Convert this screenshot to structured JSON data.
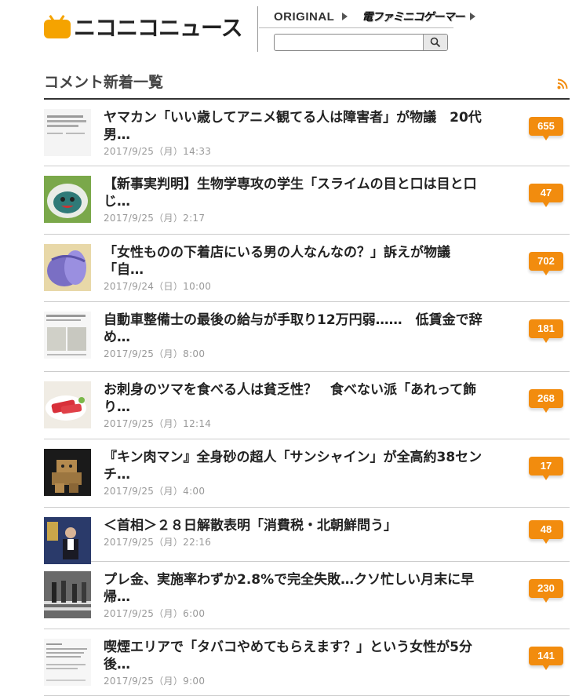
{
  "header": {
    "logo_text": "ニコニコニュース",
    "nav_original": "ORIGINAL",
    "nav_famitsu": "電ファミニコゲーマー",
    "search_placeholder": ""
  },
  "section": {
    "title": "コメント新着一覧",
    "rss_icon": "rss-icon"
  },
  "colors": {
    "accent": "#f28c0e",
    "logo_orange": "#f5a300"
  },
  "items": [
    {
      "title_l1": "ヤマカン「いい歳してアニメ観てる人は障害者」が物議　20代",
      "title_l2": "男…",
      "date": "2017/9/25（月）14:33",
      "count": "655",
      "thumb": "tweet-screenshot"
    },
    {
      "title_l1": "【新事実判明】生物学専攻の学生「スライムの目と口は目と口",
      "title_l2": "じ…",
      "date": "2017/9/25（月）2:17",
      "count": "47",
      "thumb": "slime-plate"
    },
    {
      "title_l1": "「女性ものの下着店にいる男の人なんなの？」訴えが物議",
      "title_l2": "「自…",
      "date": "2017/9/24（日）10:00",
      "count": "702",
      "thumb": "lingerie"
    },
    {
      "title_l1": "自動車整備士の最後の給与が手取り12万円弱……　低賃金で辞",
      "title_l2": "め…",
      "date": "2017/9/25（月）8:00",
      "count": "181",
      "thumb": "tweet-payslip"
    },
    {
      "title_l1": "お刺身のツマを食べる人は貧乏性？　食べない派「あれって飾",
      "title_l2": "り…",
      "date": "2017/9/25（月）12:14",
      "count": "268",
      "thumb": "sashimi"
    },
    {
      "title_l1": "『キン肉マン』全身砂の超人「サンシャイン」が全高約38セン",
      "title_l2": "チ…",
      "date": "2017/9/25（月）4:00",
      "count": "17",
      "thumb": "sunshine-figure"
    },
    {
      "title_l1": "＜首相＞２８日解散表明「消費税・北朝鮮問う」",
      "title_l2": "",
      "date": "2017/9/25（月）22:16",
      "count": "48",
      "thumb": "prime-minister"
    },
    {
      "title_l1": "プレ金、実施率わずか2.8%で完全失敗…クソ忙しい月末に早",
      "title_l2": "帰…",
      "date": "2017/9/25（月）6:00",
      "count": "230",
      "thumb": "crosswalk"
    },
    {
      "title_l1": "喫煙エリアで「タバコやめてもらえます？」という女性が5分",
      "title_l2": "後…",
      "date": "2017/9/25（月）9:00",
      "count": "141",
      "thumb": "tweet-text"
    }
  ]
}
